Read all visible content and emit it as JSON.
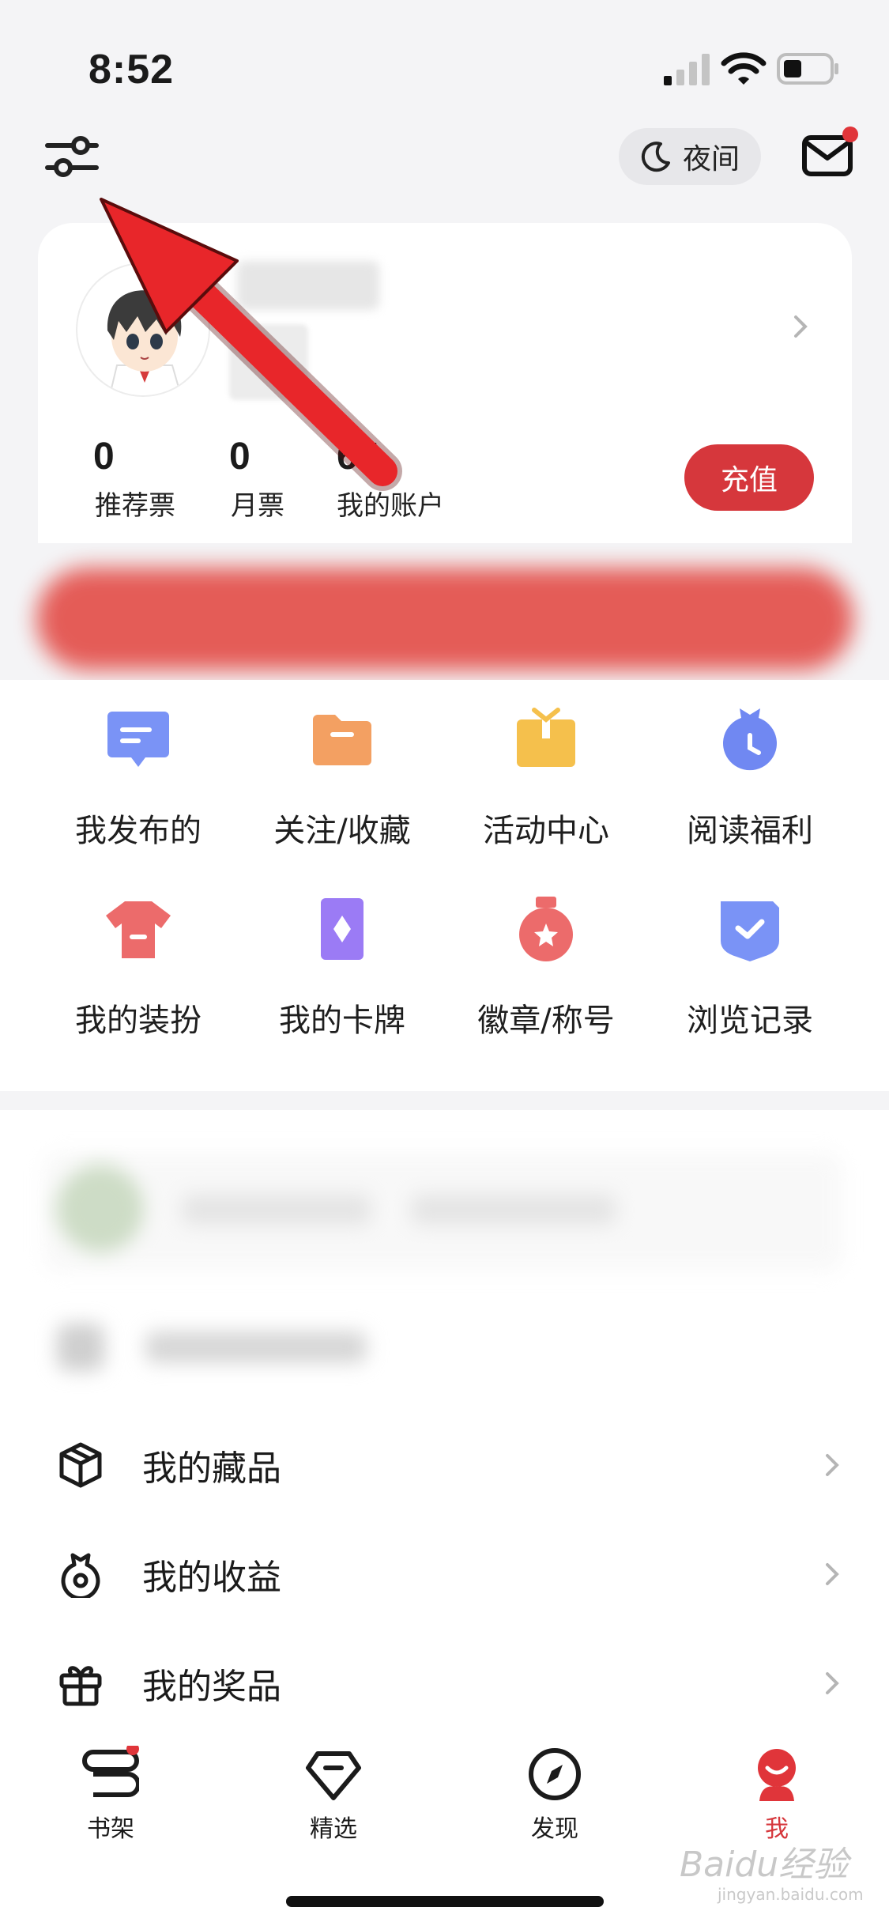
{
  "status_bar": {
    "time": "8:52"
  },
  "header": {
    "night_mode_label": "夜间"
  },
  "profile": {
    "stats": [
      {
        "value": "0",
        "label": "推荐票"
      },
      {
        "value": "0",
        "label": "月票"
      },
      {
        "value": "65",
        "label": "我的账户"
      }
    ],
    "recharge_label": "充值"
  },
  "grid": [
    {
      "label": "我发布的",
      "icon": "message-icon",
      "color": "#6f8ef7"
    },
    {
      "label": "关注/收藏",
      "icon": "folder-icon",
      "color": "#f39a5b"
    },
    {
      "label": "活动中心",
      "icon": "gift-box-icon",
      "color": "#f7c04a"
    },
    {
      "label": "阅读福利",
      "icon": "clock-bag-icon",
      "color": "#6f86f2"
    },
    {
      "label": "我的装扮",
      "icon": "tshirt-icon",
      "color": "#ec6a6a"
    },
    {
      "label": "我的卡牌",
      "icon": "card-icon",
      "color": "#9a7af5"
    },
    {
      "label": "徽章/称号",
      "icon": "medal-icon",
      "color": "#ec6a6a"
    },
    {
      "label": "浏览记录",
      "icon": "shield-check-icon",
      "color": "#6f8ef7"
    }
  ],
  "menu": [
    {
      "label": "我的藏品",
      "icon": "cube-icon"
    },
    {
      "label": "我的收益",
      "icon": "money-bag-icon"
    },
    {
      "label": "我的奖品",
      "icon": "gift-icon"
    }
  ],
  "tabs": [
    {
      "label": "书架",
      "icon": "bookshelf-icon",
      "active": false
    },
    {
      "label": "精选",
      "icon": "diamond-icon",
      "active": false
    },
    {
      "label": "发现",
      "icon": "compass-icon",
      "active": false
    },
    {
      "label": "我",
      "icon": "profile-icon",
      "active": true
    }
  ],
  "watermark": {
    "text": "Baidu经验",
    "sub": "jingyan.baidu.com"
  },
  "colors": {
    "accent": "#d6373c",
    "arrow": "#e8262a"
  }
}
